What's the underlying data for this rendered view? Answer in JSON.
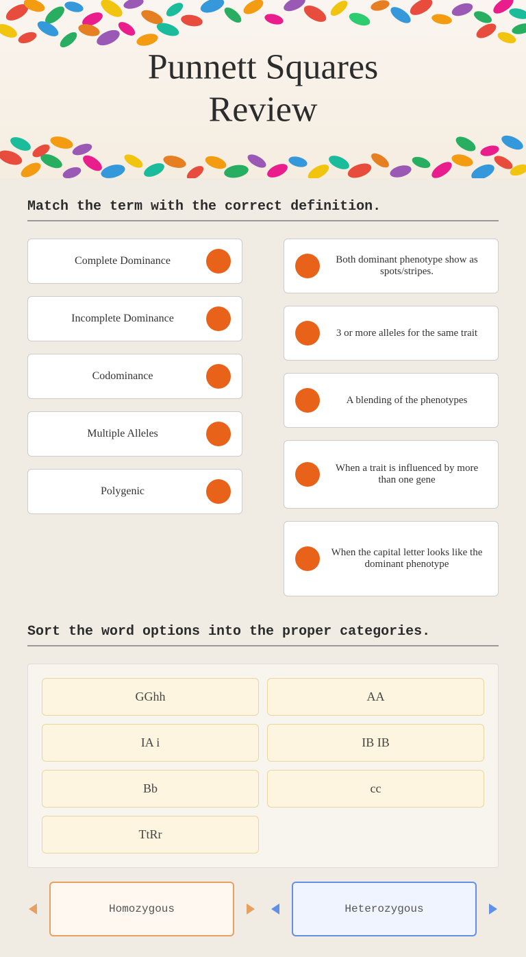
{
  "header": {
    "title_line1": "Punnett Squares",
    "title_line2": "Review"
  },
  "match_section": {
    "instruction": "Match the term with the correct definition.",
    "terms": [
      {
        "id": "term1",
        "label": "Complete Dominance"
      },
      {
        "id": "term2",
        "label": "Incomplete Dominance"
      },
      {
        "id": "term3",
        "label": "Codominance"
      },
      {
        "id": "term4",
        "label": "Multiple Alleles"
      },
      {
        "id": "term5",
        "label": "Polygenic"
      }
    ],
    "definitions": [
      {
        "id": "def1",
        "text": "Both dominant phenotype show as spots/stripes."
      },
      {
        "id": "def2",
        "text": "3 or more alleles for the same trait"
      },
      {
        "id": "def3",
        "text": "A blending of the phenotypes"
      },
      {
        "id": "def4",
        "text": "When a trait is influenced by more than one gene"
      },
      {
        "id": "def5",
        "text": "When the capital letter looks like the dominant phenotype"
      }
    ]
  },
  "sort_section": {
    "instruction": "Sort the word options into the proper categories.",
    "words": [
      {
        "id": "w1",
        "label": "GGhh"
      },
      {
        "id": "w2",
        "label": "AA"
      },
      {
        "id": "w3",
        "label": "IA i"
      },
      {
        "id": "w4",
        "label": "IB IB"
      },
      {
        "id": "w5",
        "label": "Bb"
      },
      {
        "id": "w6",
        "label": "cc"
      },
      {
        "id": "w7",
        "label": "TtRr"
      }
    ],
    "categories": [
      {
        "id": "cat1",
        "label": "Homozygous",
        "color": "orange"
      },
      {
        "id": "cat2",
        "label": "Heterozygous",
        "color": "blue"
      }
    ]
  },
  "colors": {
    "orange_circle": "#e8621a",
    "orange_border": "#e8a060",
    "blue_border": "#6090e8",
    "background_main": "#f0ece4",
    "card_bg": "#ffffff",
    "word_chip_bg": "#fdf5e0"
  }
}
